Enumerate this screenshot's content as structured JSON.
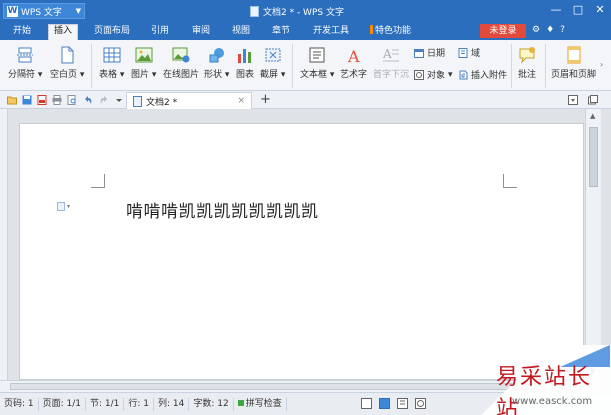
{
  "titlebar": {
    "app_name": "WPS 文字",
    "document_title": "文档2 * - WPS 文字",
    "controls": [
      "—",
      "□",
      "✕"
    ]
  },
  "ribbon_tabs": [
    {
      "label": "开始",
      "active": false
    },
    {
      "label": "插入",
      "active": true
    },
    {
      "label": "页面布局",
      "active": false
    },
    {
      "label": "引用",
      "active": false
    },
    {
      "label": "审阅",
      "active": false
    },
    {
      "label": "视图",
      "active": false
    },
    {
      "label": "章节",
      "active": false
    },
    {
      "label": "开发工具",
      "active": false
    },
    {
      "label": "特色功能",
      "active": false
    }
  ],
  "login_label": "未登录",
  "tabbar_icons": [
    "⚙",
    "♦",
    "?"
  ],
  "ribbon": {
    "pagebreak": "分隔符",
    "blank_page": "空白页",
    "table": "表格",
    "picture": "图片",
    "online_picture": "在线图片",
    "shapes": "形状",
    "chart": "图表",
    "screenshot": "截屏",
    "textbox": "文本框",
    "wordart": "艺术字",
    "drop_cap": "首字下沉",
    "date": "日期",
    "field": "域",
    "object": "对象",
    "attachment": "插入附件",
    "comment": "批注",
    "header_footer": "页眉和页脚"
  },
  "doc_tab": {
    "label": "文档2 *",
    "plus": "+"
  },
  "document": {
    "text": "啃啃啃凯凯凯凯凯凯凯凯"
  },
  "statusbar": {
    "page": "页码: 1",
    "pages": "页面: 1/1",
    "section": "节: 1/1",
    "row": "行: 1",
    "col": "列: 14",
    "word_count": "字数: 12",
    "spell_check": "拼写检查"
  },
  "watermark": {
    "text": "易采站长站",
    "url": "www.easck.com"
  },
  "colors": {
    "titlebar": "#2a6ebd",
    "login": "#e24b3b",
    "spell_check_indicator": "#3aa83a"
  }
}
